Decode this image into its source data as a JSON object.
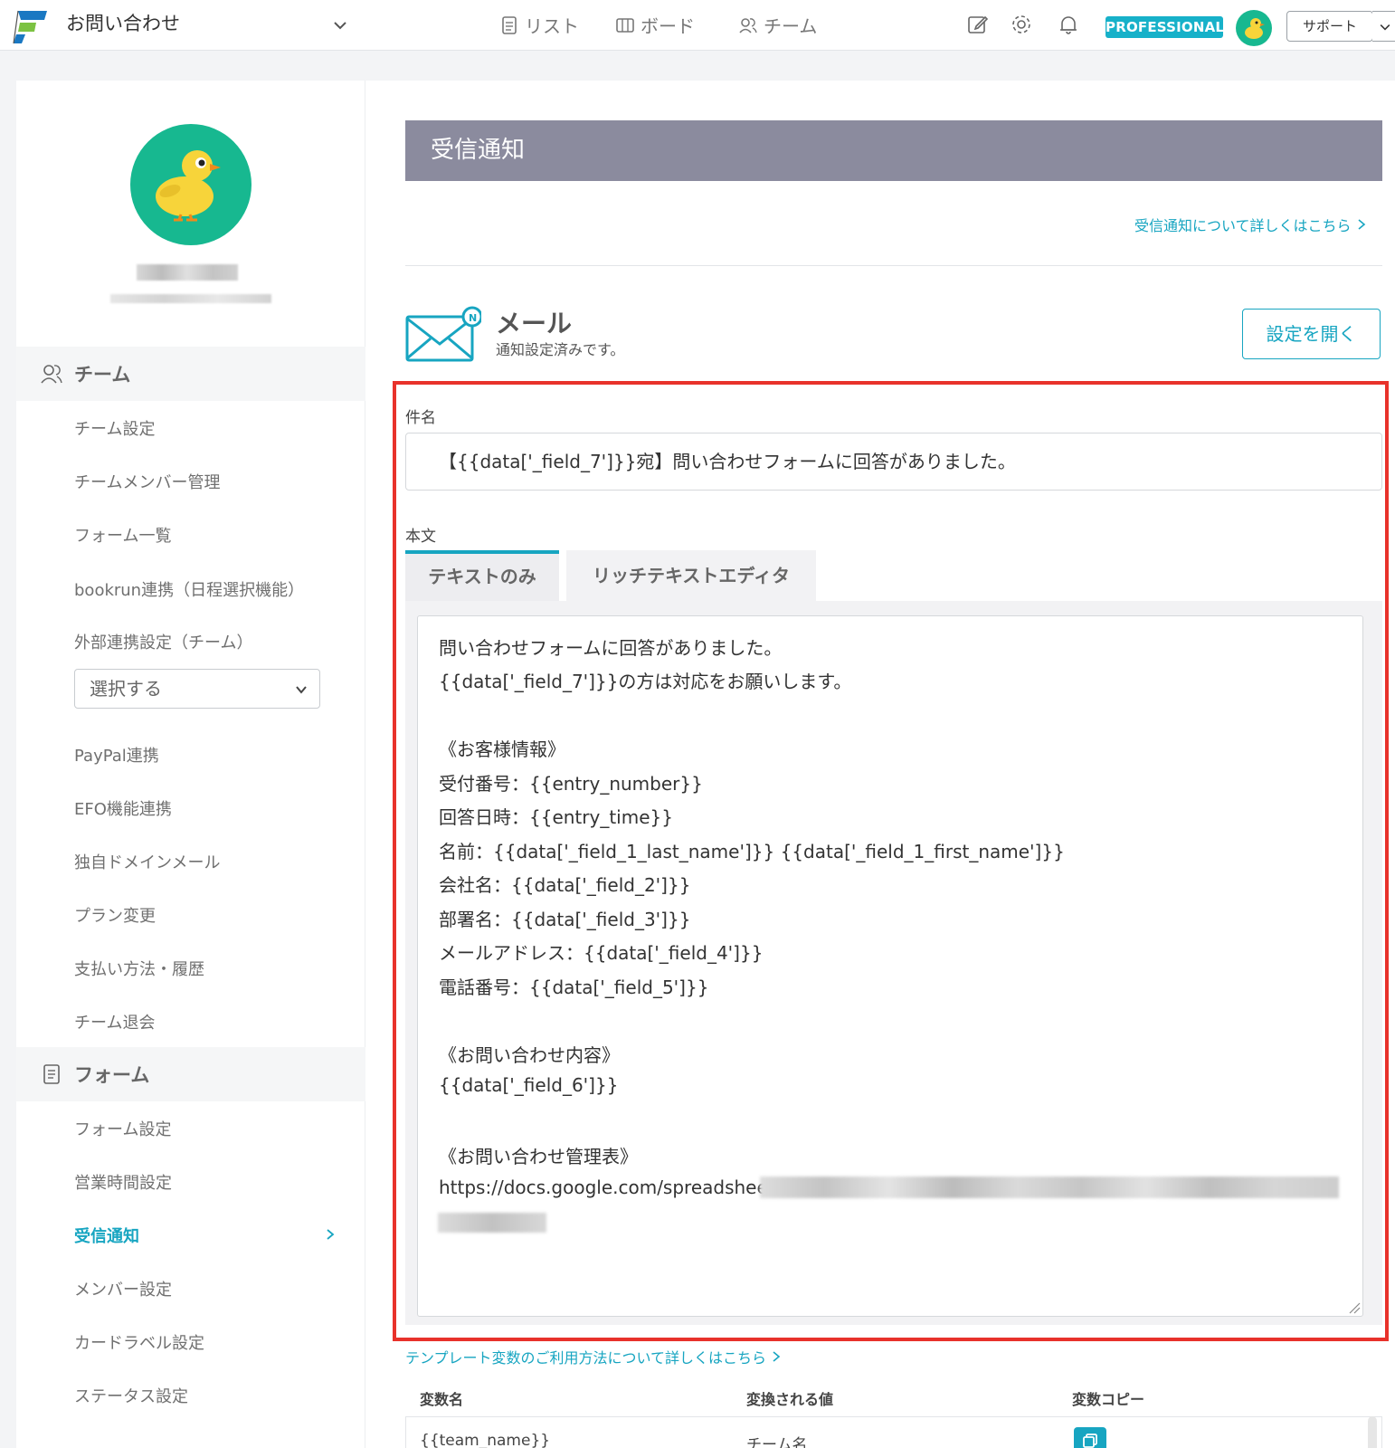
{
  "header": {
    "app_title": "お問い合わせ",
    "nav": [
      "リスト",
      "ボード",
      "チーム"
    ],
    "plan_badge": "PROFESSIONAL",
    "support_label": "サポート"
  },
  "sidebar": {
    "team_section": "チーム",
    "team_items": [
      "チーム設定",
      "チームメンバー管理",
      "フォーム一覧",
      "bookrun連携（日程選択機能）",
      "外部連携設定（チーム）"
    ],
    "select_label": "選択する",
    "team_items2": [
      "PayPal連携",
      "EFO機能連携",
      "独自ドメインメール",
      "プラン変更",
      "支払い方法・履歴",
      "チーム退会"
    ],
    "form_section": "フォーム",
    "form_items": [
      "フォーム設定",
      "営業時間設定",
      "受信通知",
      "メンバー設定",
      "カードラベル設定",
      "ステータス設定"
    ]
  },
  "main": {
    "page_title": "受信通知",
    "help_link": "受信通知について詳しくはこちら",
    "mail_title": "メール",
    "mail_status": "通知設定済みです。",
    "open_button": "設定を開く",
    "subject_label": "件名",
    "subject_value": "【{{data['_field_7']}}宛】問い合わせフォームに回答がありました。",
    "body_label": "本文",
    "tabs": [
      "テキストのみ",
      "リッチテキストエディタ"
    ],
    "body_lines": [
      "問い合わせフォームに回答がありました。",
      "{{data['_field_7']}}の方は対応をお願いします。",
      "",
      "《お客様情報》",
      "受付番号：{{entry_number}}",
      "回答日時：{{entry_time}}",
      "名前：{{data['_field_1_last_name']}} {{data['_field_1_first_name']}}",
      "会社名：{{data['_field_2']}}",
      "部署名：{{data['_field_3']}}",
      "メールアドレス：{{data['_field_4']}}",
      "電話番号：{{data['_field_5']}}",
      "",
      "《お問い合わせ内容》",
      "{{data['_field_6']}}",
      "",
      "《お問い合わせ管理表》",
      "https://docs.google.com/spreadsheets"
    ],
    "template_link": "テンプレート変数のご利用方法について詳しくはこちら",
    "table_headers": [
      "変数名",
      "変換される値",
      "変数コピー"
    ],
    "table_rows": [
      {
        "var": "{{team_name}}",
        "value": "チーム名"
      }
    ]
  },
  "colors": {
    "accent": "#17a5c1",
    "header_bar": "#8b8b9e",
    "highlight_frame": "#e8322b",
    "avatar_bg": "#17b890"
  }
}
